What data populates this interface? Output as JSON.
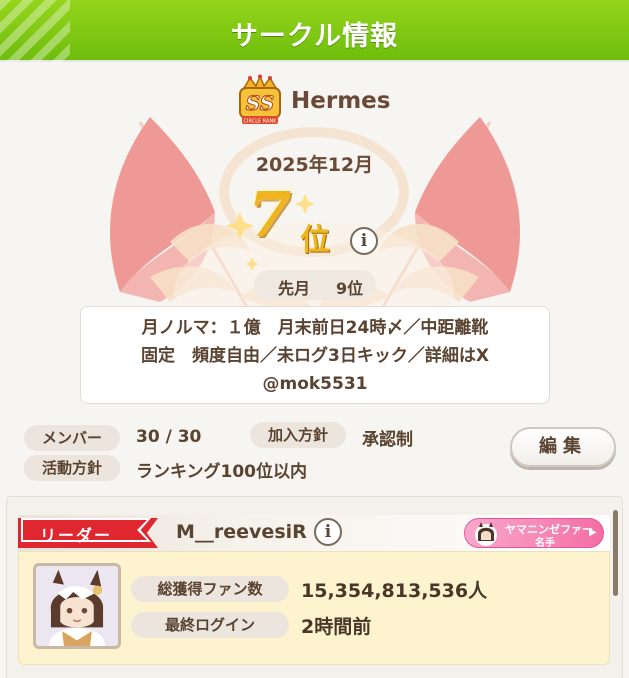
{
  "header": {
    "title": "サークル情報"
  },
  "circle": {
    "rank_badge_text": "SS",
    "rank_badge_caption": "CIRCLE RANK",
    "name": "Hermes",
    "month": "2025年12月",
    "rank_number": "7",
    "rank_suffix": "位",
    "info_glyph": "i",
    "previous_month_label": "先月",
    "previous_month_rank": "9位",
    "notice_lines": [
      "月ノルマ：１億　月末前日24時〆／中距離靴",
      "固定　頻度自由／未ログ3日キック／詳細はX",
      "@mok5531"
    ]
  },
  "details": {
    "members_label": "メンバー",
    "members_value": "30 / 30",
    "join_policy_label": "加入方針",
    "join_policy_value": "承認制",
    "activity_policy_label": "活動方針",
    "activity_policy_value": "ランキング100位以内",
    "edit_button_label": "編集"
  },
  "member_list": [
    {
      "role": "リーダー",
      "name": "M__reevesiR",
      "info_glyph": "i",
      "trainer_badge_name": "ヤマニンゼファー",
      "trainer_badge_rank": "名手",
      "fans_label": "総獲得ファン数",
      "fans_value": "15,354,813,536人",
      "last_login_label": "最終ログイン",
      "last_login_value": "2時間前"
    }
  ],
  "icons": {
    "rank_badge": "crown-badge-icon",
    "info": "info-icon",
    "trainer": "horse-girl-icon",
    "avatar": "character-avatar"
  },
  "colors": {
    "header_green": "#7fc614",
    "gold": "#f0b41c",
    "leader_red": "#e0262f",
    "card_yellow": "#fdf3cf",
    "badge_pink": "#f46ea4",
    "text_brown": "#5a4330"
  }
}
